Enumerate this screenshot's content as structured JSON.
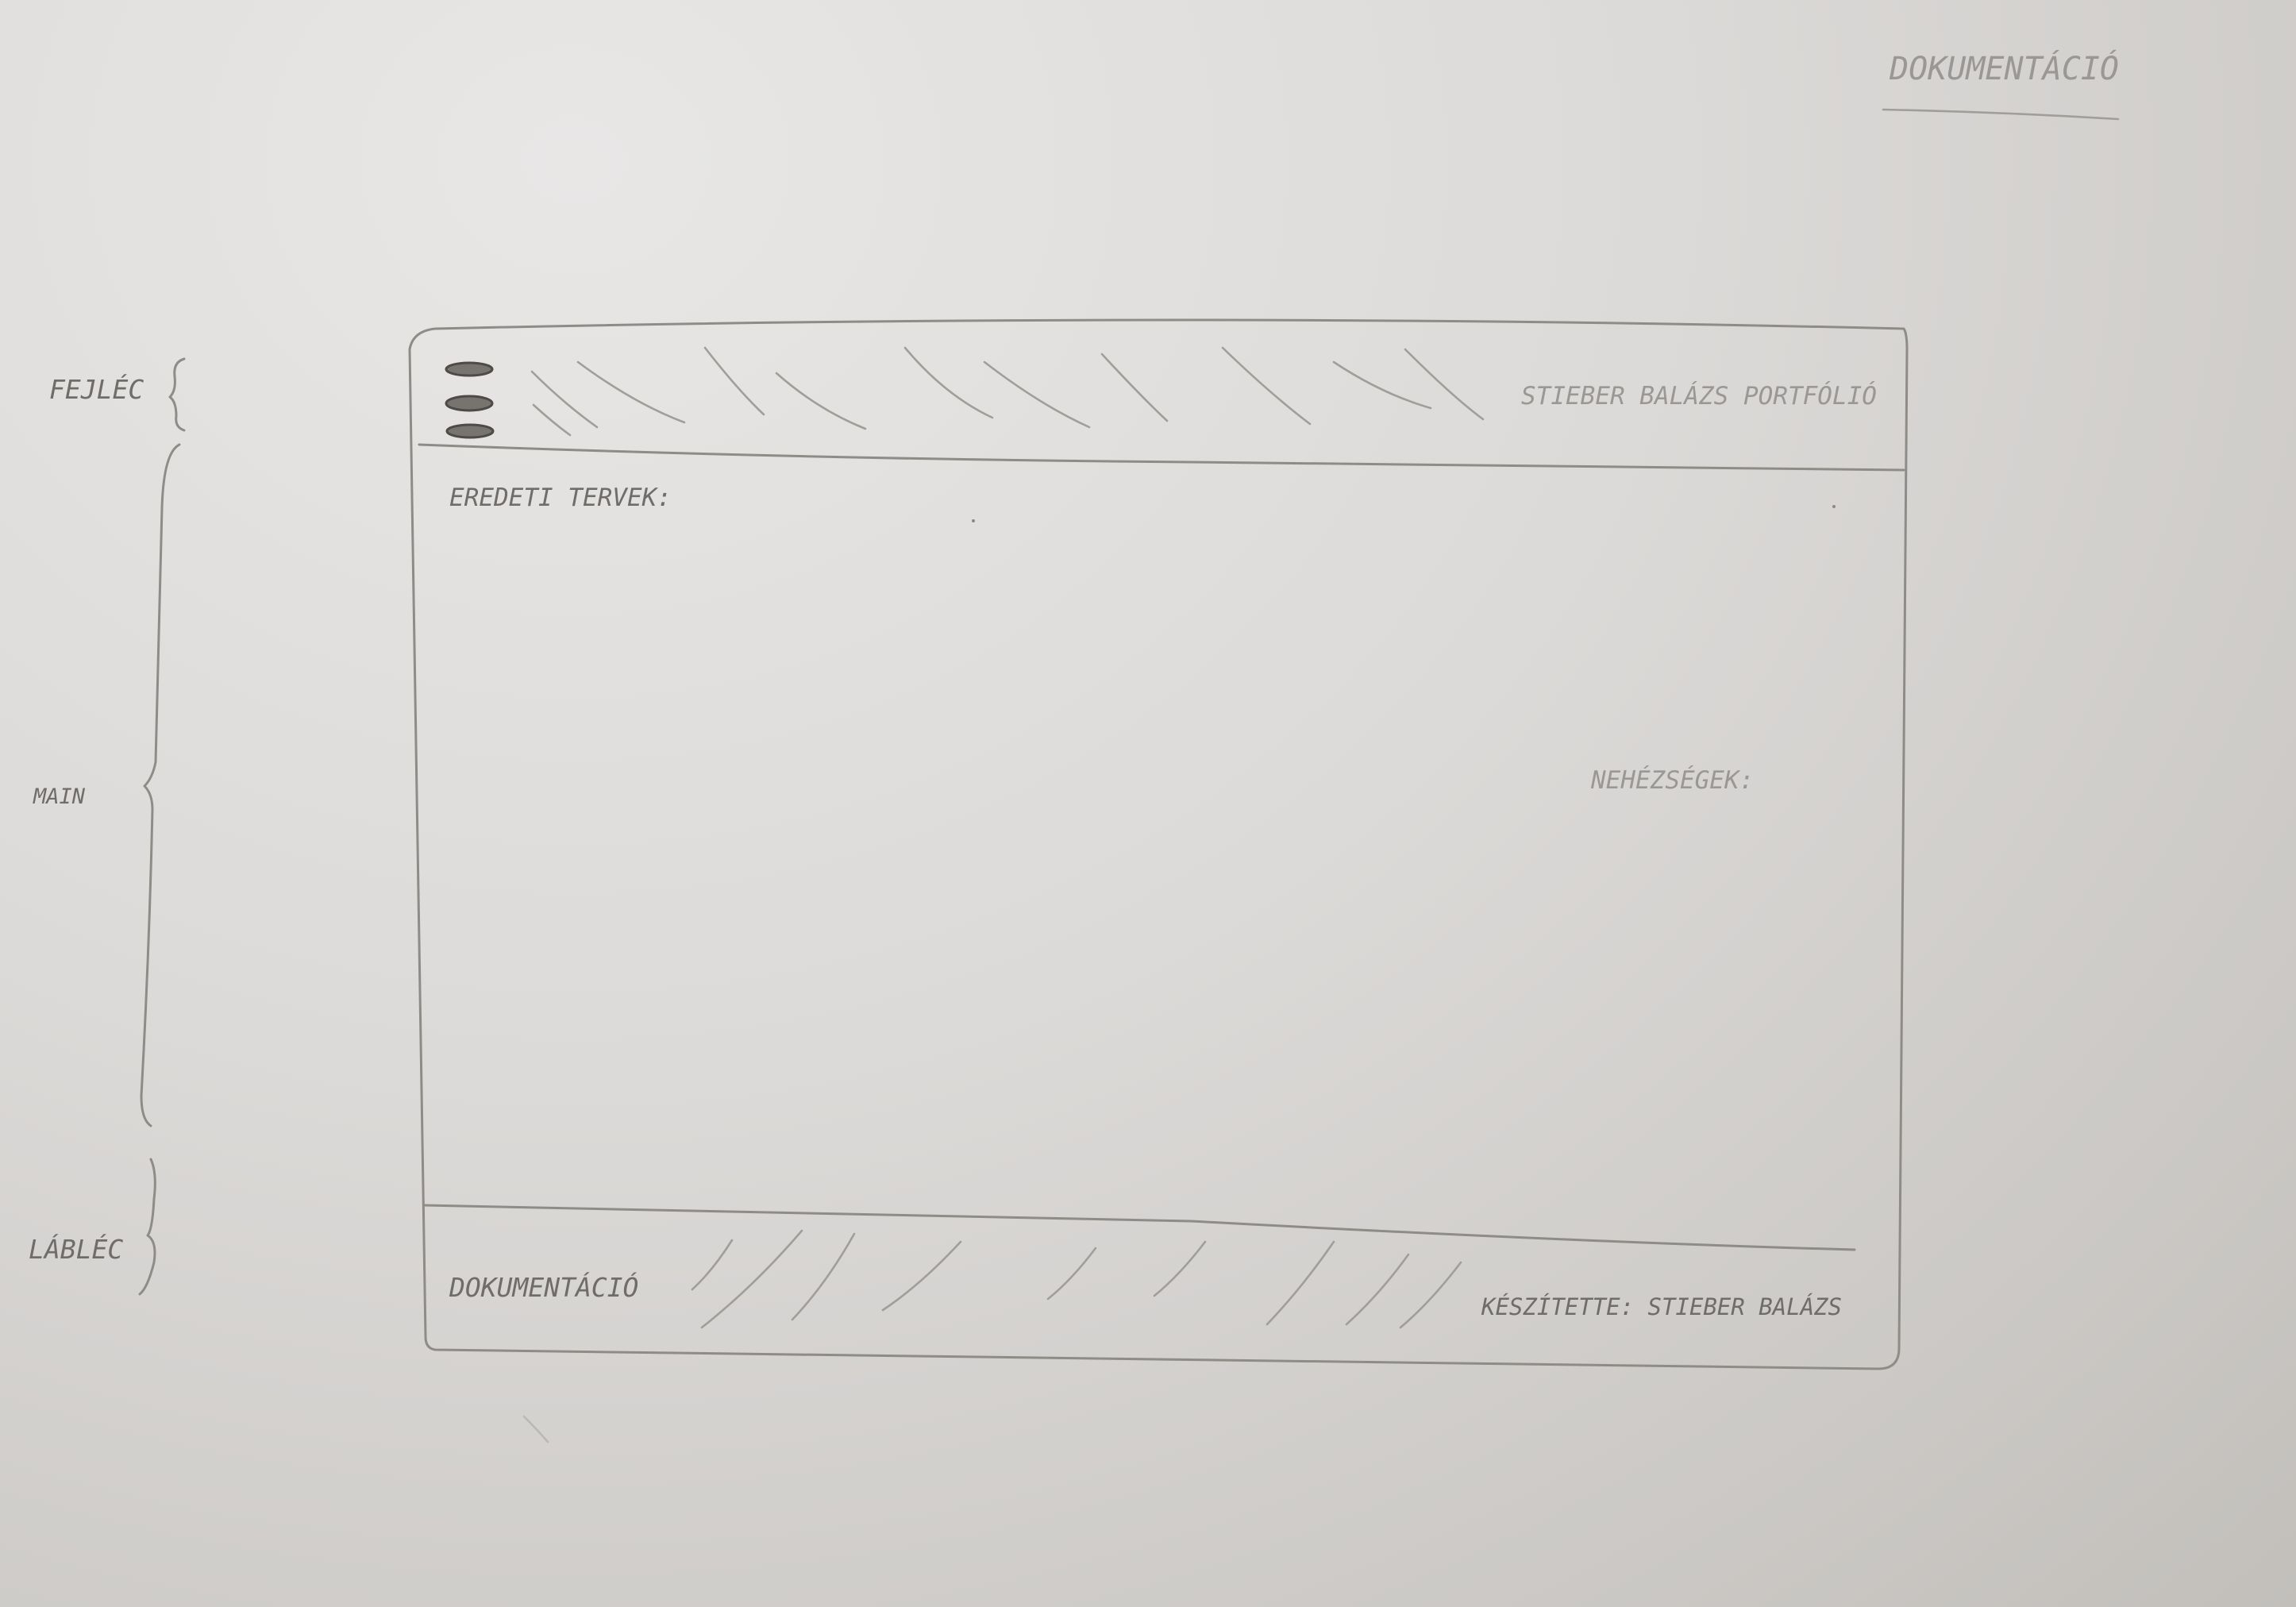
{
  "page_heading": "DOKUMENTÁCIÓ",
  "section_labels": {
    "header": "FEJLÉC",
    "main": "MAIN",
    "footer": "LÁBLÉC"
  },
  "header": {
    "menu_icon": "hamburger-menu-icon",
    "title": "STIEBER BALÁZS PORTFÓLIÓ"
  },
  "main": {
    "original_plans_label": "EREDETI TERVEK:",
    "difficulties_label": "NEHÉZSÉGEK:"
  },
  "footer": {
    "link": "DOKUMENTÁCIÓ",
    "credit": "KÉSZÍTETTE: STIEBER BALÁZS"
  }
}
